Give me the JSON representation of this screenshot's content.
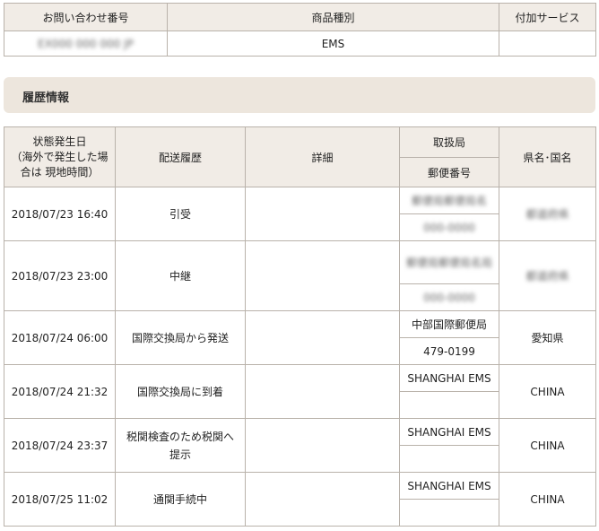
{
  "top": {
    "headers": [
      "お問い合わせ番号",
      "商品種別",
      "付加サービス"
    ],
    "tracking_number": "EX000 000 000 JP",
    "product_type": "EMS",
    "extra_service": ""
  },
  "section": {
    "title": "履歴情報"
  },
  "history": {
    "headers": {
      "date": "状態発生日\n（海外で発生した場合は 現地時間）",
      "status": "配送履歴",
      "detail": "詳細",
      "office": "取扱局",
      "postal": "郵便番号",
      "region": "県名･国名"
    },
    "rows": [
      {
        "date": "2018/07/23 16:40",
        "status": "引受",
        "detail": "",
        "office": "郵便局郵便局名",
        "postal": "000-0000",
        "region": "都道府県",
        "blur": true
      },
      {
        "date": "2018/07/23 23:00",
        "status": "中継",
        "detail": "",
        "office": "郵便局郵便局名局",
        "postal": "000-0000",
        "region": "都道府県",
        "blur": true
      },
      {
        "date": "2018/07/24 06:00",
        "status": "国際交換局から発送",
        "detail": "",
        "office": "中部国際郵便局",
        "postal": "479-0199",
        "region": "愛知県",
        "blur": false
      },
      {
        "date": "2018/07/24 21:32",
        "status": "国際交換局に到着",
        "detail": "",
        "office": "SHANGHAI EMS",
        "postal": "",
        "region": "CHINA",
        "blur": false
      },
      {
        "date": "2018/07/24 23:37",
        "status": "税関検査のため税関へ提示",
        "detail": "",
        "office": "SHANGHAI EMS",
        "postal": "",
        "region": "CHINA",
        "blur": false
      },
      {
        "date": "2018/07/25 11:02",
        "status": "通関手続中",
        "detail": "",
        "office": "SHANGHAI EMS",
        "postal": "",
        "region": "CHINA",
        "blur": false
      }
    ]
  }
}
